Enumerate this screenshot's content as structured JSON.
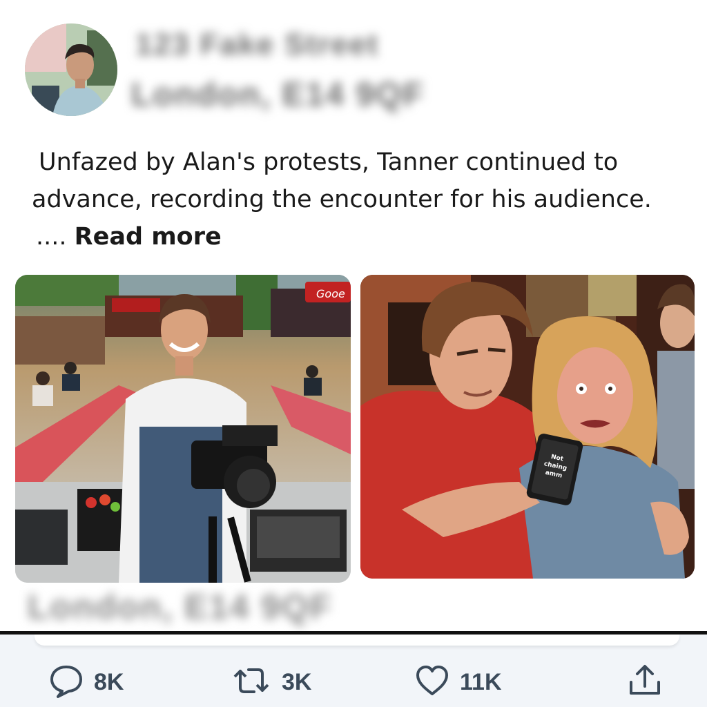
{
  "post": {
    "author_name_blurred": "123 Fake Street",
    "author_handle_blurred": "London, E14 9QF",
    "text_line1": "Unfazed by Alan's protests, Tanner continued to",
    "text_line2": "advance, recording the encounter for his audience.",
    "ellipsis": "....",
    "read_more": "Read more",
    "caption_blurred": "London, E14 9QF"
  },
  "images": {
    "left_sign": "Gooe",
    "right_phone_text": "Not chaing amm"
  },
  "actions": {
    "replies": "8K",
    "reposts": "3K",
    "likes": "11K"
  },
  "icons": [
    "avatar",
    "reply-icon",
    "repost-icon",
    "like-icon",
    "share-icon"
  ]
}
